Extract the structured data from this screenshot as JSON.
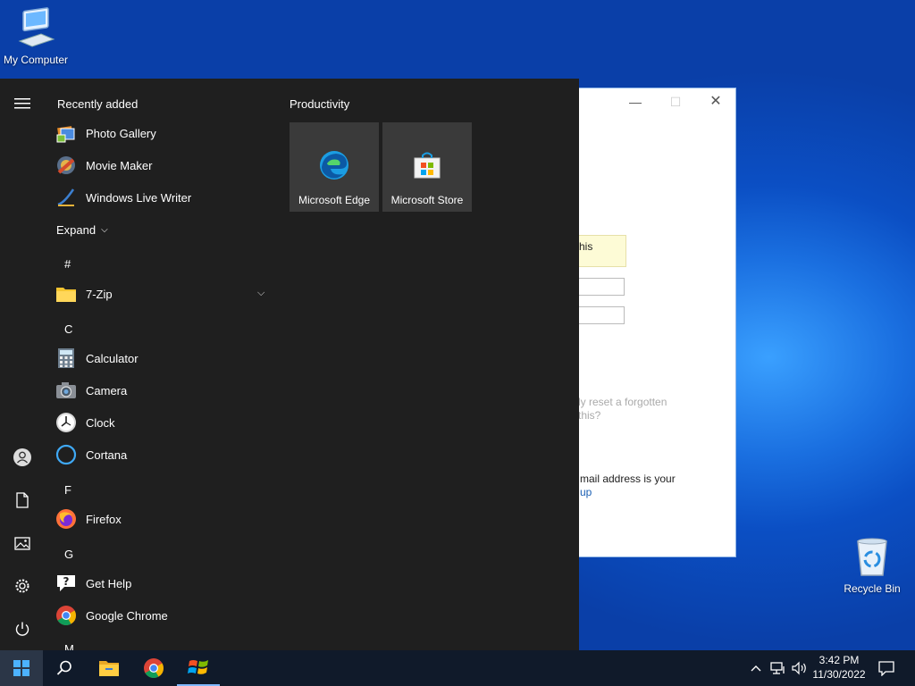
{
  "desktop": {
    "icons": [
      {
        "label": "My Computer"
      },
      {
        "label": "Recycle Bin"
      }
    ]
  },
  "background_window": {
    "note_text": "his",
    "text_reset": "ly reset a forgotten",
    "text_reset2": "this?",
    "text_email": "mail address is your",
    "text_link": "up"
  },
  "start_menu": {
    "recently_added_title": "Recently added",
    "recent": [
      {
        "label": "Photo Gallery",
        "icon": "photo-gallery-icon"
      },
      {
        "label": "Movie Maker",
        "icon": "movie-maker-icon"
      },
      {
        "label": "Windows Live Writer",
        "icon": "live-writer-icon"
      }
    ],
    "expand_label": "Expand",
    "letters": [
      "#",
      "C",
      "F",
      "G",
      "M"
    ],
    "apps": [
      {
        "label": "7-Zip",
        "icon": "folder-icon"
      },
      {
        "label": "Calculator",
        "icon": "calculator-icon"
      },
      {
        "label": "Camera",
        "icon": "camera-icon"
      },
      {
        "label": "Clock",
        "icon": "clock-icon"
      },
      {
        "label": "Cortana",
        "icon": "cortana-icon"
      },
      {
        "label": "Firefox",
        "icon": "firefox-icon"
      },
      {
        "label": "Get Help",
        "icon": "get-help-icon"
      },
      {
        "label": "Google Chrome",
        "icon": "chrome-icon"
      }
    ],
    "tile_group_title": "Productivity",
    "tiles": [
      {
        "label": "Microsoft Edge",
        "icon": "edge-icon"
      },
      {
        "label": "Microsoft Store",
        "icon": "store-icon"
      }
    ]
  },
  "taskbar": {
    "time": "3:42 PM",
    "date": "11/30/2022"
  },
  "colors": {
    "start_bg": "#1f1f1f",
    "tile_bg": "#3a3a3a",
    "taskbar_bg": "#101a2a",
    "accent": "#0b4fc4"
  }
}
